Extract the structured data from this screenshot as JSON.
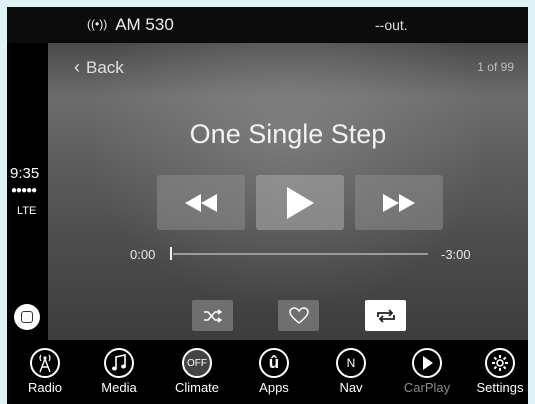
{
  "status_bar": {
    "radio": "AM 530",
    "temperature": "--out."
  },
  "carplay_strip": {
    "time": "9:35",
    "signal_dots": "●●●●●",
    "network": "LTE"
  },
  "now_playing": {
    "back_label": "Back",
    "track_counter": "1 of 99",
    "title": "One Single Step",
    "elapsed": "0:00",
    "remaining": "-3:00",
    "progress": 0,
    "repeat_active": true
  },
  "nav": {
    "items": [
      {
        "label": "Radio",
        "icon": "radio-tower-icon"
      },
      {
        "label": "Media",
        "icon": "music-note-icon"
      },
      {
        "label": "Climate",
        "icon": "climate-off-icon",
        "icon_text": "OFF"
      },
      {
        "label": "Apps",
        "icon": "apps-icon",
        "icon_text": "û"
      },
      {
        "label": "Nav",
        "icon": "compass-icon",
        "icon_text": "N"
      },
      {
        "label": "CarPlay",
        "icon": "carplay-icon"
      },
      {
        "label": "Settings",
        "icon": "gear-icon"
      }
    ]
  },
  "colors": {
    "background": "#dff3f7",
    "screen": "#000000",
    "active_button": "#ffffff",
    "inactive_label": "#8a8a8a"
  }
}
